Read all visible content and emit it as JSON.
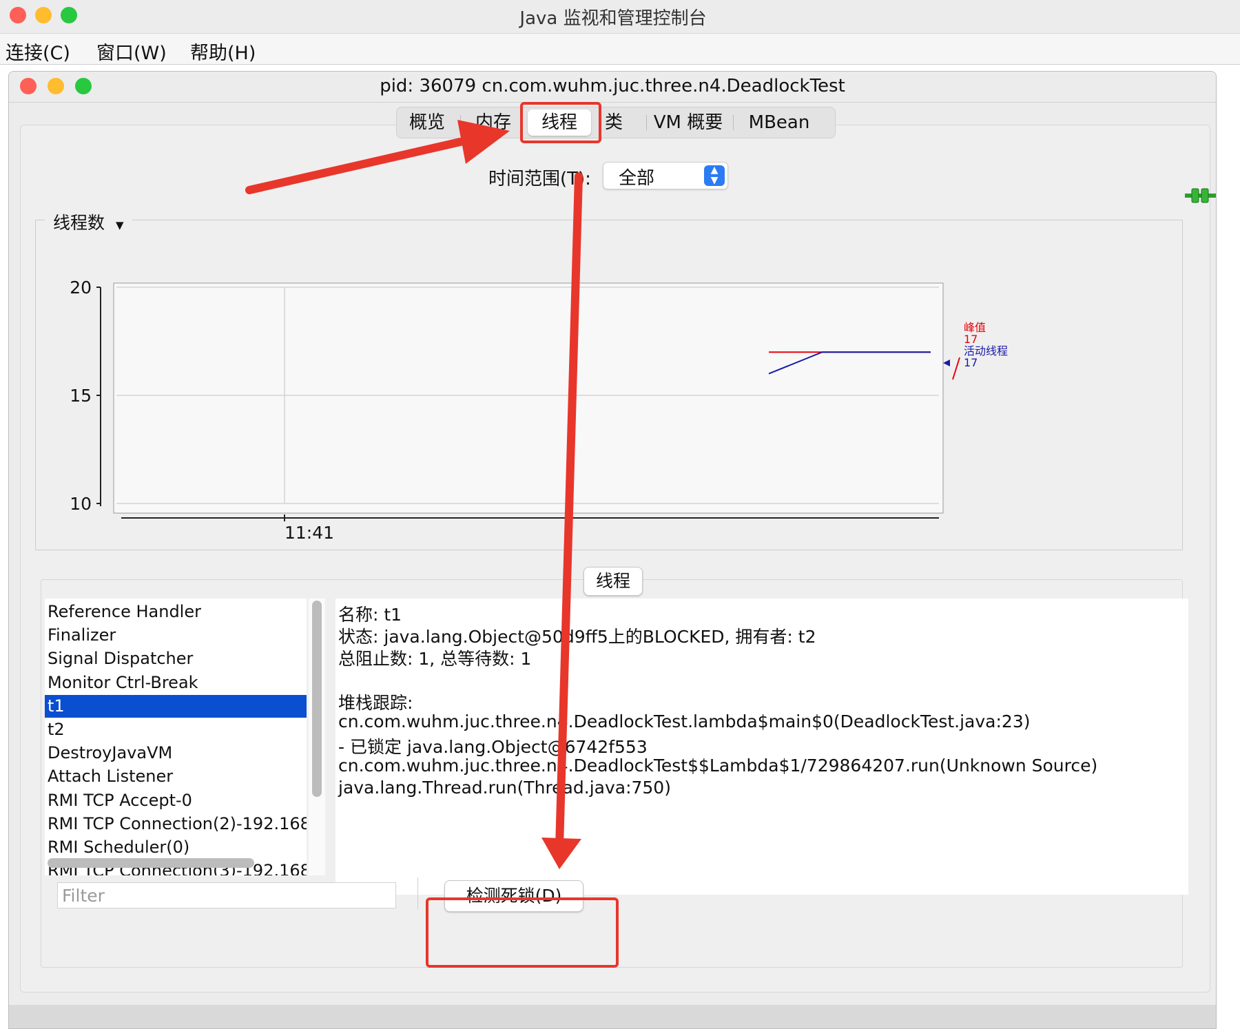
{
  "outer_window": {
    "title": "Java 监视和管理控制台"
  },
  "menu": {
    "items": [
      "连接(C)",
      "窗口(W)",
      "帮助(H)"
    ]
  },
  "inner_window": {
    "title": "pid: 36079 cn.com.wuhm.juc.three.n4.DeadlockTest"
  },
  "tabs": {
    "items": [
      "概览",
      "内存",
      "线程",
      "类",
      "VM 概要",
      "MBean"
    ],
    "active": "线程"
  },
  "time_range": {
    "label": "时间范围(T):",
    "value": "全部"
  },
  "chart": {
    "title": "线程数"
  },
  "chart_data": {
    "type": "line",
    "title": "线程数",
    "ylim": [
      10,
      20
    ],
    "yticks": [
      "20",
      "15",
      "10"
    ],
    "xticks": [
      "11:41"
    ],
    "series": [
      {
        "name": "峰值",
        "color": "#e8000b",
        "value_label": "17",
        "points": [
          [
            0.0,
            17
          ],
          [
            1.0,
            17
          ]
        ]
      },
      {
        "name": "活动线程",
        "color": "#1a1aa8",
        "value_label": "17",
        "points": [
          [
            0.0,
            16.0
          ],
          [
            0.33,
            17
          ],
          [
            1.0,
            17
          ]
        ]
      }
    ]
  },
  "threads_panel": {
    "header": "线程",
    "list": [
      "Reference Handler",
      "Finalizer",
      "Signal Dispatcher",
      "Monitor Ctrl-Break",
      "t1",
      "t2",
      "DestroyJavaVM",
      "Attach Listener",
      "RMI TCP Accept-0",
      "RMI TCP Connection(2)-192.168",
      "RMI Scheduler(0)",
      "RMI TCP Connection(3)-192.168"
    ],
    "selected": "t1",
    "detail": {
      "lines": [
        "名称: t1",
        "状态: java.lang.Object@50d9ff5上的BLOCKED, 拥有者: t2",
        "总阻止数: 1, 总等待数: 1",
        "",
        "堆栈跟踪:",
        "cn.com.wuhm.juc.three.n4.DeadlockTest.lambda$main$0(DeadlockTest.java:23)",
        "   - 已锁定 java.lang.Object@6742f553",
        "cn.com.wuhm.juc.three.n4.DeadlockTest$$Lambda$1/729864207.run(Unknown Source)",
        "java.lang.Thread.run(Thread.java:750)"
      ]
    },
    "filter_placeholder": "Filter",
    "deadlock_button": "检测死锁(D)"
  },
  "colors": {
    "selection": "#0a4fd0",
    "annotation": "#e8362b",
    "peak": "#e8000b",
    "live": "#1a1aa8"
  }
}
